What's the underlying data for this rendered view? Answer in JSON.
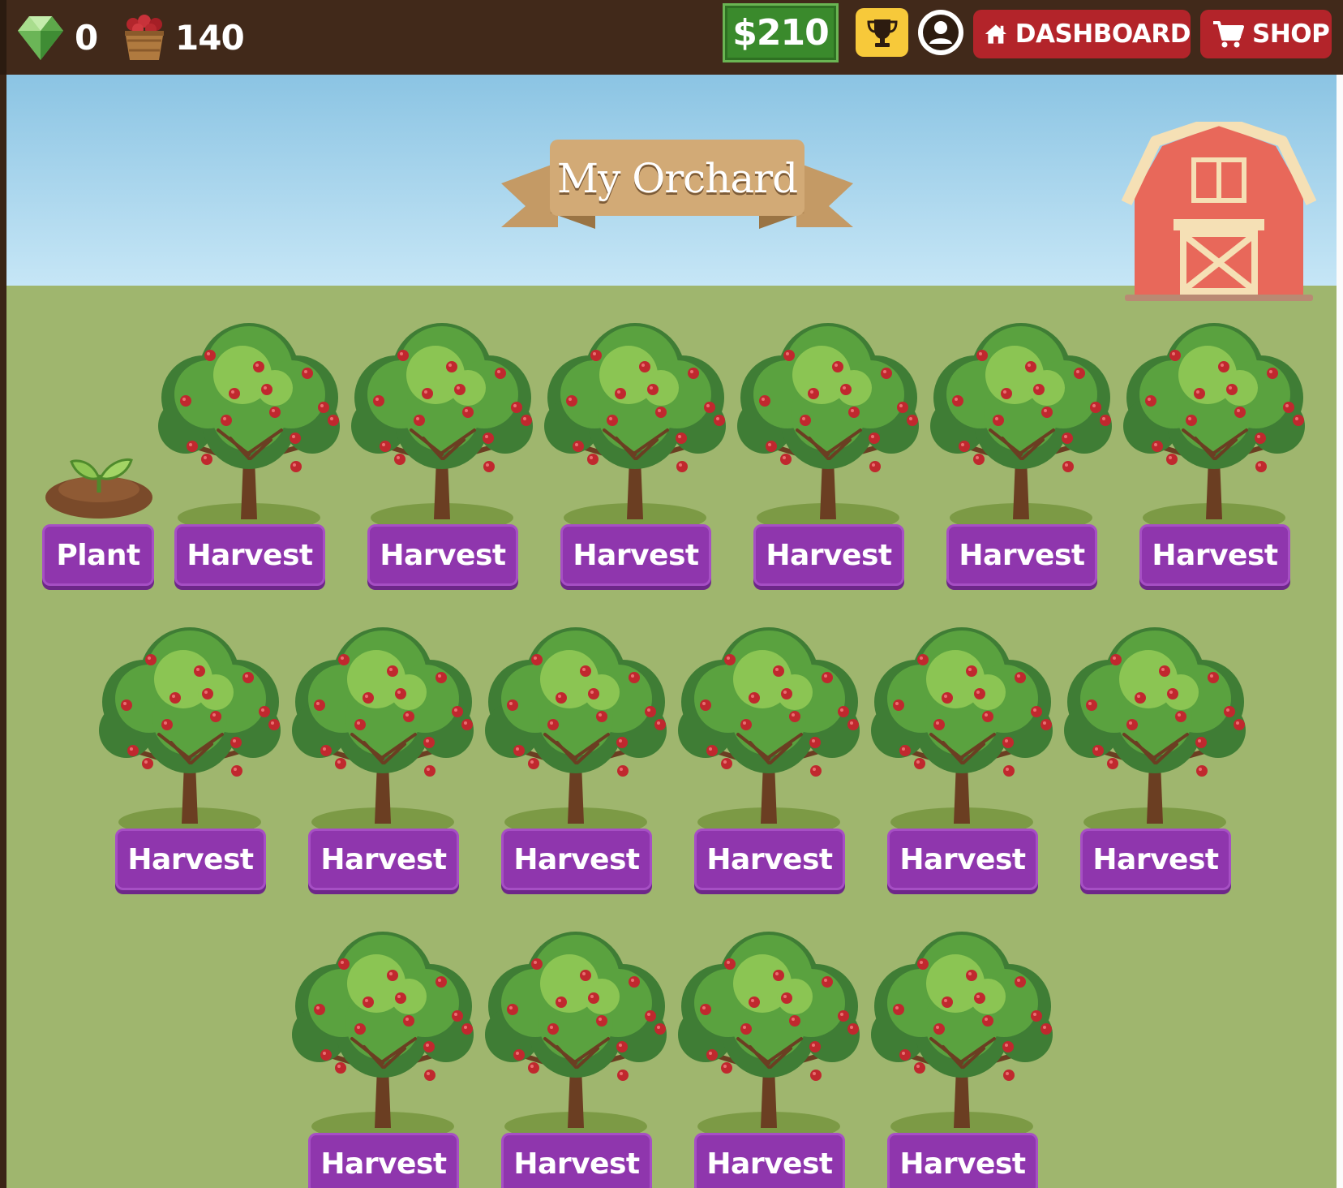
{
  "header": {
    "gems": "0",
    "apples": "140",
    "money": "$210",
    "dashboard_label": "DASHBOARD",
    "shop_label": "SHOP",
    "icons": [
      "gem-icon",
      "apple-basket-icon",
      "trophy-icon",
      "user-icon",
      "home-icon",
      "cart-icon"
    ]
  },
  "scene": {
    "title": "My Orchard",
    "colors": {
      "topbar": "#41291a",
      "money": "#3a8a2c",
      "trophy": "#f7c93a",
      "nav_button": "#b3242a",
      "action_button": "#8f36ad",
      "sky": "#8bc4e3",
      "grass": "#9fb66e",
      "barn": "#e8685a"
    }
  },
  "orchard": {
    "rows": [
      [
        {
          "state": "seedling",
          "action": "Plant"
        },
        {
          "state": "apple-tree",
          "action": "Harvest"
        },
        {
          "state": "apple-tree",
          "action": "Harvest"
        },
        {
          "state": "apple-tree",
          "action": "Harvest"
        },
        {
          "state": "apple-tree",
          "action": "Harvest"
        },
        {
          "state": "apple-tree",
          "action": "Harvest"
        },
        {
          "state": "apple-tree",
          "action": "Harvest"
        }
      ],
      [
        {
          "state": "apple-tree",
          "action": "Harvest"
        },
        {
          "state": "apple-tree",
          "action": "Harvest"
        },
        {
          "state": "apple-tree",
          "action": "Harvest"
        },
        {
          "state": "apple-tree",
          "action": "Harvest"
        },
        {
          "state": "apple-tree",
          "action": "Harvest"
        },
        {
          "state": "apple-tree",
          "action": "Harvest"
        }
      ],
      [
        {
          "state": "apple-tree",
          "action": "Harvest"
        },
        {
          "state": "apple-tree",
          "action": "Harvest"
        },
        {
          "state": "apple-tree",
          "action": "Harvest"
        },
        {
          "state": "apple-tree",
          "action": "Harvest"
        }
      ]
    ]
  }
}
